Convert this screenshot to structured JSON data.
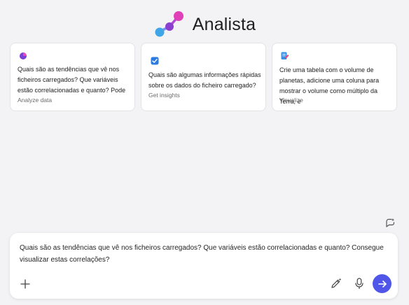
{
  "header": {
    "title": "Analista",
    "logo_colors": [
      "#e040b8",
      "#8a3fd0",
      "#3f9ae0"
    ]
  },
  "cards": [
    {
      "icon": "chart-icon",
      "lines": [
        "Quais são as tendências que vê nos",
        "ficheiros carregados? Que variáveis",
        "estão correlacionadas e quanto? Pode"
      ],
      "category": "Analyze data"
    },
    {
      "icon": "checkbox-icon",
      "lines": [
        "Quais são algumas informações rápidas",
        "sobre os dados do ficheiro carregado?"
      ],
      "category": "Get insights"
    },
    {
      "icon": "document-edit-icon",
      "lines": [
        "Crie uma tabela com o volume de",
        "planetas, adicione uma coluna para",
        "mostrar o volume como múltiplo da Terra, e"
      ],
      "category": "Visualize"
    }
  ],
  "composer": {
    "message": "Quais são as tendências que vê nos ficheiros carregados? Que variáveis estão correlacionadas e quanto? Consegue visualizar estas correlações?",
    "send_color": "#4f56e8"
  },
  "icons": {
    "history": "chat-history-icon",
    "add": "plus-icon",
    "prompt": "pen-sparkle-icon",
    "mic": "microphone-icon",
    "send": "arrow-right-icon"
  }
}
